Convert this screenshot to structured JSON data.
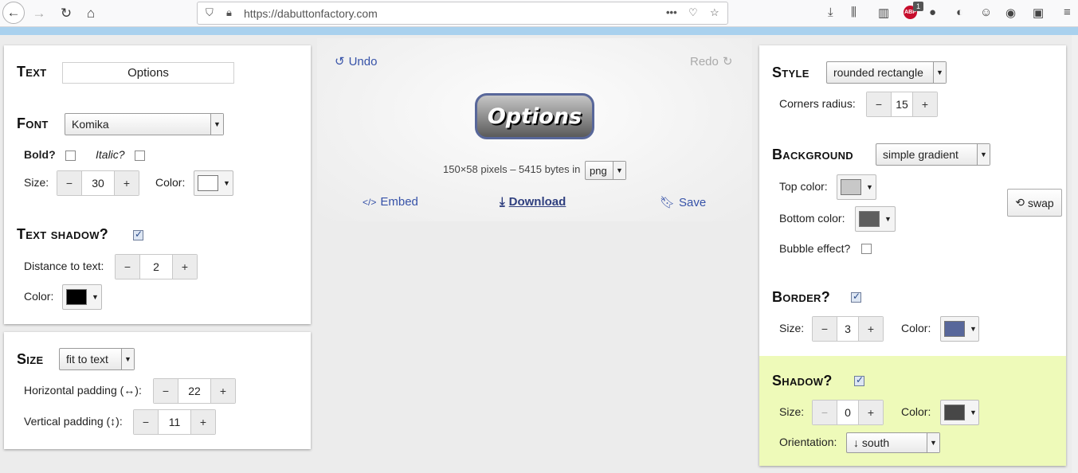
{
  "browser": {
    "url": "https://dabuttonfactory.com",
    "abp_count": "1"
  },
  "text_panel": {
    "heading": "Text",
    "text_value": "Options"
  },
  "font_panel": {
    "heading": "Font",
    "font_selected": "Komika",
    "bold_label": "Bold?",
    "italic_label": "Italic?",
    "size_label": "Size:",
    "size_value": "30",
    "color_label": "Color:",
    "text_color": "#ffffff"
  },
  "text_shadow": {
    "heading": "Text shadow?",
    "distance_label": "Distance to text:",
    "distance_value": "2",
    "color_label": "Color:",
    "color": "#000000"
  },
  "size_panel": {
    "heading": "Size",
    "mode": "fit to text",
    "h_padding_label": "Horizontal padding (↔):",
    "h_padding_value": "22",
    "v_padding_label": "Vertical padding (↕):",
    "v_padding_value": "11"
  },
  "center": {
    "undo_label": "Undo",
    "redo_label": "Redo",
    "button_text": "Options",
    "info_text": "150×58 pixels – 5415 bytes in",
    "format": "png",
    "embed_label": "Embed",
    "download_label": "Download",
    "save_label": "Save"
  },
  "style_panel": {
    "heading": "Style",
    "style_selected": "rounded rectangle",
    "corners_label": "Corners radius:",
    "corners_value": "15"
  },
  "background_panel": {
    "heading": "Background",
    "bg_selected": "simple gradient",
    "top_color_label": "Top color:",
    "top_color": "#c8c8c8",
    "bottom_color_label": "Bottom color:",
    "bottom_color": "#5e5e5e",
    "bubble_label": "Bubble effect?",
    "swap_label": "swap"
  },
  "border_panel": {
    "heading": "Border?",
    "size_label": "Size:",
    "size_value": "3",
    "color_label": "Color:",
    "color": "#58679a"
  },
  "shadow_panel": {
    "heading": "Shadow?",
    "size_label": "Size:",
    "size_value": "0",
    "color_label": "Color:",
    "color": "#474747",
    "orientation_label": "Orientation:",
    "orientation_value": "↓ south",
    "bg_color": "#eefab9"
  }
}
